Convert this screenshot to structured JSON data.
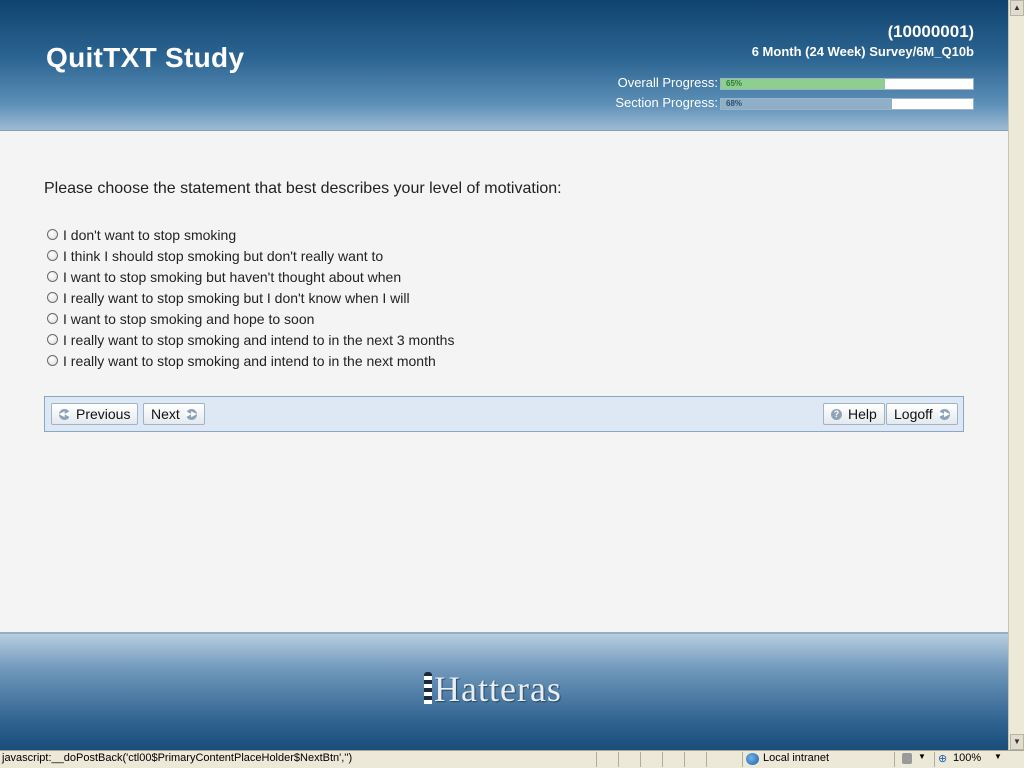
{
  "header": {
    "study_title": "QuitTXT Study",
    "participant_id_open": "(",
    "participant_id": "10000001",
    "participant_id_close": ")",
    "survey_path": "6 Month (24 Week) Survey/6M_Q10b",
    "overall_progress": {
      "label": "Overall Progress:",
      "value_text": "65%",
      "percent": 65,
      "fill_color": "#8ccf8f",
      "text_color": "#2e7d32"
    },
    "section_progress": {
      "label": "Section Progress:",
      "value_text": "68%",
      "percent": 68,
      "fill_color": "#8faec8",
      "text_color": "#2b4f74"
    }
  },
  "question": {
    "text": "Please choose the statement that best describes your level of motivation:",
    "options": [
      "I don't want to stop smoking",
      "I think I should stop smoking but don't really want to",
      "I want to stop smoking but haven't thought about when",
      "I really want to stop smoking but I don't know when I will",
      "I want to stop smoking and hope to soon",
      "I really want to stop smoking and intend to in the next 3 months",
      "I really want to stop smoking and intend to in the next month"
    ]
  },
  "nav": {
    "previous_label": "Previous",
    "next_label": "Next",
    "help_label": "Help",
    "logoff_label": "Logoff"
  },
  "footer": {
    "logo_text": "Hatteras"
  },
  "statusbar": {
    "text": "javascript:__doPostBack('ctl00$PrimaryContentPlaceHolder$NextBtn','')",
    "zone": "Local intranet",
    "zoom": "100%"
  },
  "icons": {
    "previous": "rewind-icon",
    "next": "forward-icon",
    "help": "help-icon",
    "logoff": "forward-icon",
    "zone": "globe-icon",
    "zoom": "magnifier-icon"
  }
}
